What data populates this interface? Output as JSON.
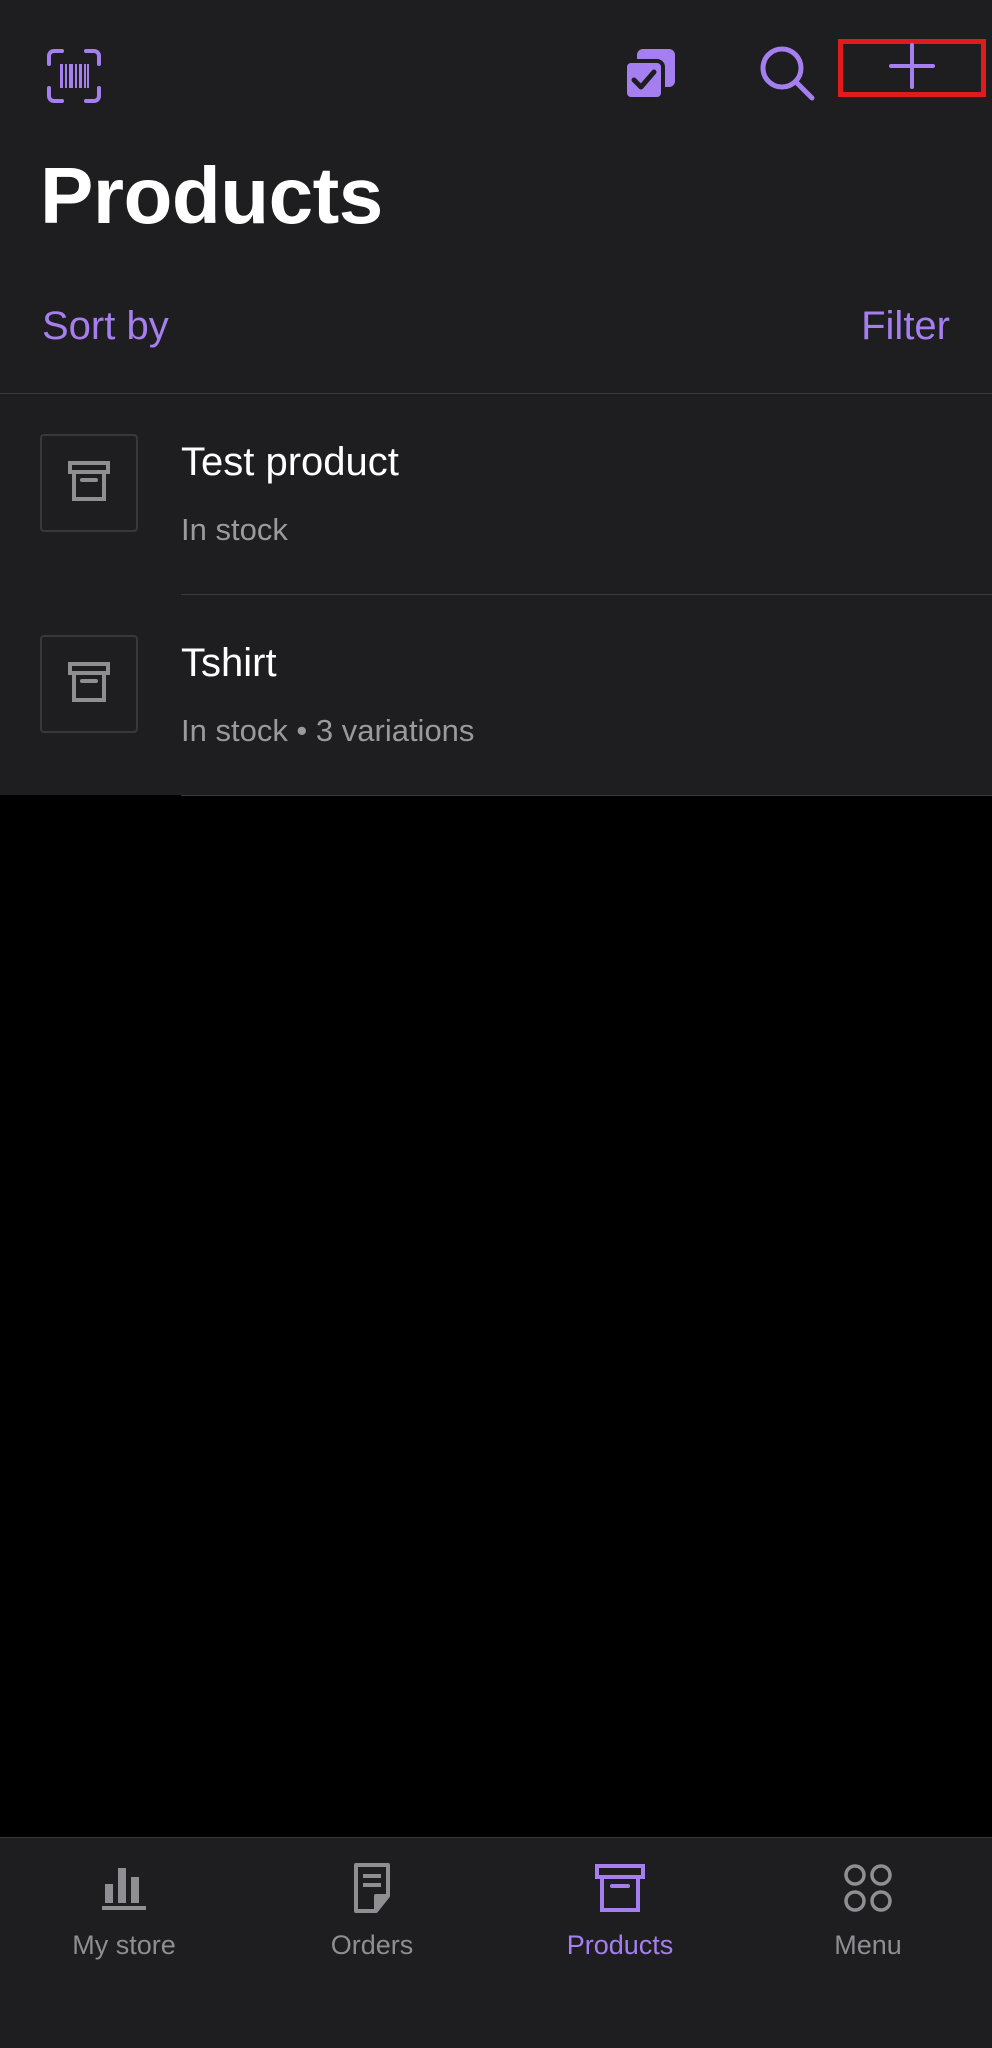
{
  "colors": {
    "accent": "#a57ff0",
    "background": "#1e1e20",
    "empty_area": "#000000",
    "text_primary": "#ffffff",
    "text_secondary": "#9a9a9e",
    "tab_inactive": "#8e8e93",
    "highlight_box": "#e01b1b"
  },
  "toolbar": {
    "barcode_icon": "barcode-scan-icon",
    "bulk_edit_icon": "bulk-edit-checkbox-icon",
    "search_icon": "search-icon",
    "add_icon": "plus-icon"
  },
  "header": {
    "title": "Products"
  },
  "list_controls": {
    "sort_label": "Sort by",
    "filter_label": "Filter"
  },
  "products": [
    {
      "name": "Test product",
      "meta": "In stock",
      "thumbnail_icon": "archive-box-icon"
    },
    {
      "name": "Tshirt",
      "meta": "In stock • 3 variations",
      "thumbnail_icon": "archive-box-icon"
    }
  ],
  "tab_bar": {
    "tabs": [
      {
        "label": "My store",
        "icon": "bar-chart-icon",
        "active": false
      },
      {
        "label": "Orders",
        "icon": "document-icon",
        "active": false
      },
      {
        "label": "Products",
        "icon": "archive-box-icon",
        "active": true
      },
      {
        "label": "Menu",
        "icon": "four-circles-icon",
        "active": false
      }
    ]
  }
}
